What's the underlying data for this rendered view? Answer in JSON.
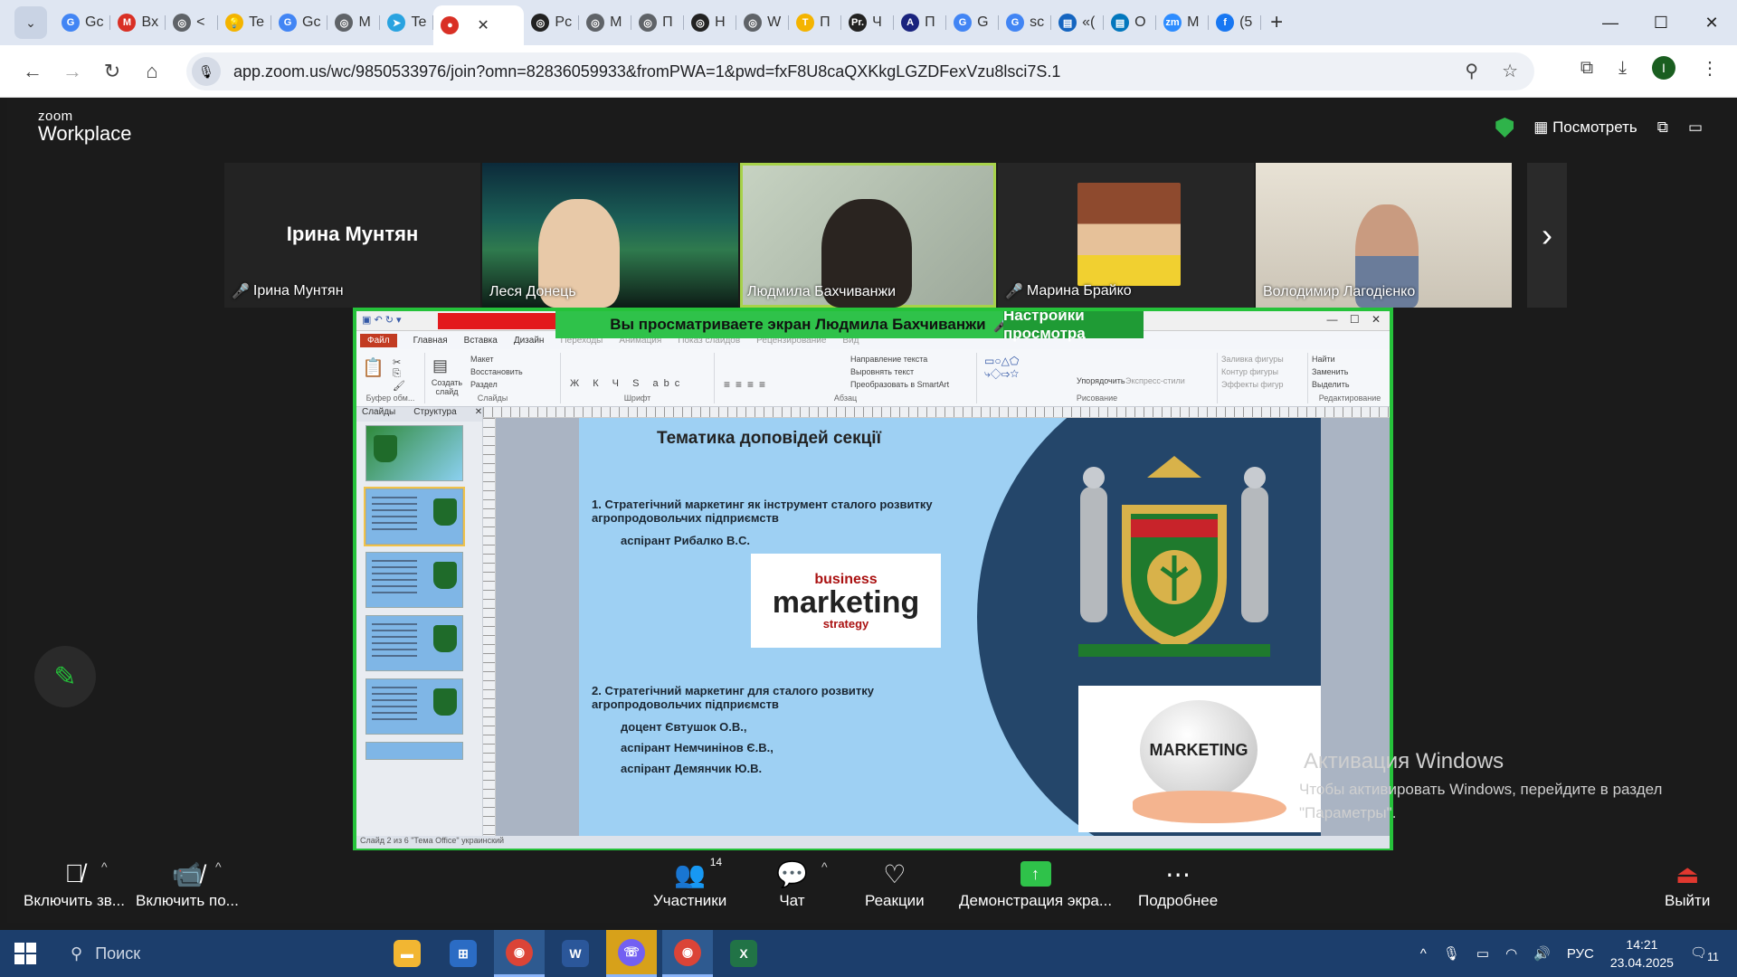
{
  "browser": {
    "tabs": [
      {
        "label": "Gc",
        "color": "#4285f4",
        "glyph": "G"
      },
      {
        "label": "Bx",
        "color": "#d93025",
        "glyph": "M"
      },
      {
        "label": "<",
        "color": "#5f6368",
        "glyph": "◎"
      },
      {
        "label": "Te",
        "color": "#f4b400",
        "glyph": "💡"
      },
      {
        "label": "Gc",
        "color": "#4285f4",
        "glyph": "G"
      },
      {
        "label": "M",
        "color": "#5f6368",
        "glyph": "◎"
      },
      {
        "label": "Te",
        "color": "#2aa3e0",
        "glyph": "➤"
      },
      {
        "label": "",
        "color": "#d93025",
        "glyph": "●",
        "active": true
      },
      {
        "label": "Pc",
        "color": "#222",
        "glyph": "◎"
      },
      {
        "label": "M",
        "color": "#5f6368",
        "glyph": "◎"
      },
      {
        "label": "П",
        "color": "#5f6368",
        "glyph": "◎"
      },
      {
        "label": "Н",
        "color": "#222",
        "glyph": "◎"
      },
      {
        "label": "W",
        "color": "#5f6368",
        "glyph": "◎"
      },
      {
        "label": "П",
        "color": "#f4b400",
        "glyph": "T"
      },
      {
        "label": "Ч",
        "color": "#222",
        "glyph": "Pr."
      },
      {
        "label": "П",
        "color": "#1a237e",
        "glyph": "A"
      },
      {
        "label": "G",
        "color": "#4285f4",
        "glyph": "G"
      },
      {
        "label": "sc",
        "color": "#4285f4",
        "glyph": "G"
      },
      {
        "label": "«(",
        "color": "#1565c0",
        "glyph": "▤"
      },
      {
        "label": "О",
        "color": "#0277bd",
        "glyph": "▤"
      },
      {
        "label": "M",
        "color": "#2d8cff",
        "glyph": "zm"
      },
      {
        "label": "(5",
        "color": "#1877f2",
        "glyph": "f"
      }
    ],
    "url": "app.zoom.us/wc/9850533976/join?omn=82836059933&fromPWA=1&pwd=fxF8U8caQXKkgLGZDFexVzu8lsci7S.1",
    "profile_initial": "I"
  },
  "zoom": {
    "logo_top": "zoom",
    "logo_bottom": "Workplace",
    "view_label": "Посмотреть",
    "participants": [
      {
        "name": "Ірина Мунтян",
        "muted": true,
        "type": "name-only",
        "big_name": "Ірина Мунтян"
      },
      {
        "name": "Леся Донець",
        "muted": false,
        "type": "aurora"
      },
      {
        "name": "Людмила Бахчиванжи",
        "muted": false,
        "type": "active"
      },
      {
        "name": "Марина Брайко",
        "muted": true,
        "type": "room"
      },
      {
        "name": "Володимир Лагодієнко",
        "muted": false,
        "type": "office"
      }
    ],
    "share_banner": "Вы просматриваете экран  Людмила Бахчиванжи",
    "view_settings": "Настройки просмотра",
    "toolbar": {
      "mic": "Включить зв...",
      "video": "Включить по...",
      "participants": "Участники",
      "participants_count": "14",
      "chat": "Чат",
      "reactions": "Реакции",
      "share": "Демонстрация экра...",
      "more": "Подробнее",
      "leave": "Выйти"
    },
    "watermark_title": "Активация Windows",
    "watermark_text1": "Чтобы активировать Windows, перейдите в раздел",
    "watermark_text2": "\"Параметры\"."
  },
  "ppt": {
    "tabs": [
      "Файл",
      "Главная",
      "Вставка",
      "Дизайн",
      "Переходы",
      "Анимация",
      "Показ слайдов",
      "Рецензирование",
      "Вид"
    ],
    "groups": [
      "Буфер обм...",
      "Слайды",
      "Шрифт",
      "Абзац",
      "Рисование",
      "Редактирование"
    ],
    "panel_tabs": [
      "Слайды",
      "Структура"
    ],
    "ribbon_items": {
      "layout": "Макет",
      "restore": "Восстановить",
      "section": "Раздел",
      "create": "Создать слайд",
      "text_dir": "Направление текста",
      "align_text": "Выровнять текст",
      "smartart": "Преобразовать в SmartArt",
      "arrange": "Упорядочить",
      "quick_styles": "Экспресс-стили",
      "fill": "Заливка фигуры",
      "outline": "Контур фигуры",
      "effects": "Эффекты фигур",
      "find": "Найти",
      "replace": "Заменить",
      "select": "Выделить"
    },
    "slide": {
      "title": "Тематика доповідей секції",
      "item1": "1. Стратегічний маркетинг як інструмент сталого розвитку агропродовольчих підприємств",
      "item1_author": "аспірант Рибалко В.С.",
      "item2": "2. Стратегічний маркетинг для сталого розвитку агропродовольчих підприємств",
      "item2_authors": [
        "доцент Євтушок О.В.,",
        "аспірант Немчинінов Є.В.,",
        "аспірант  Демянчик Ю.В."
      ],
      "wordcloud_main": "marketing",
      "wordcloud_top": "business",
      "wordcloud_sub": "strategy",
      "globe_word": "MARKETING"
    },
    "status": "Слайд 2 из 6   \"Тема Office\"   украинский"
  },
  "taskbar": {
    "search": "Поиск",
    "lang": "РУС",
    "time": "14:21",
    "date": "23.04.2025",
    "notif": "11"
  }
}
